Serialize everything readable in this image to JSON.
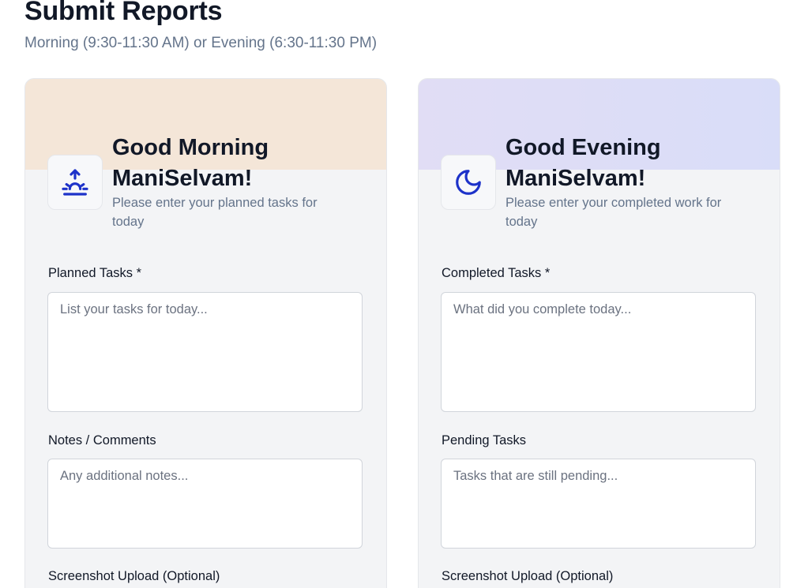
{
  "header": {
    "title": "Submit Reports",
    "subtitle": "Morning (9:30-11:30 AM) or Evening (6:30-11:30 PM)"
  },
  "morning": {
    "icon": "sunrise-icon",
    "greeting_line1": "Good Morning",
    "greeting_line2": "ManiSelvam!",
    "prompt": "Please enter your planned tasks for today",
    "planned_tasks": {
      "label": "Planned Tasks *",
      "value": "",
      "placeholder": "List your tasks for today..."
    },
    "notes": {
      "label": "Notes / Comments",
      "value": "",
      "placeholder": "Any additional notes..."
    },
    "screenshot": {
      "label": "Screenshot Upload (Optional)"
    }
  },
  "evening": {
    "icon": "moon-icon",
    "greeting_line1": "Good Evening",
    "greeting_line2": "ManiSelvam!",
    "prompt": "Please enter your completed work for today",
    "completed_tasks": {
      "label": "Completed Tasks *",
      "value": "",
      "placeholder": "What did you complete today..."
    },
    "pending_tasks": {
      "label": "Pending Tasks",
      "value": "",
      "placeholder": "Tasks that are still pending..."
    },
    "screenshot": {
      "label": "Screenshot Upload (Optional)"
    }
  },
  "colors": {
    "icon_accent": "#1d32c9",
    "morning_banner": "#f4e6d8",
    "evening_banner": "#dfdcf6",
    "card_background": "#f3f4f6",
    "muted_text": "#64748b"
  }
}
